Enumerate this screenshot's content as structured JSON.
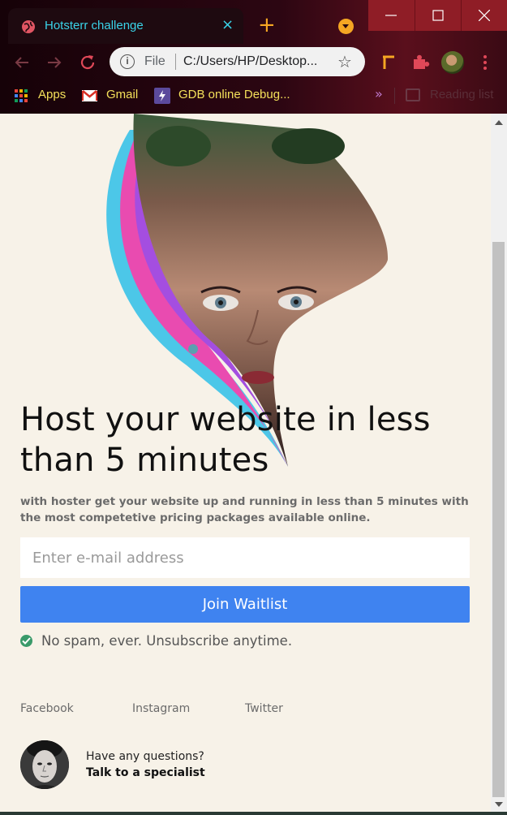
{
  "browser": {
    "tab": {
      "title": "Hotsterr challenge",
      "close": "×"
    },
    "new_tab": "+",
    "omnibox": {
      "scheme": "File",
      "url": "C:/Users/HP/Desktop...",
      "info": "i"
    },
    "bookmarks": [
      {
        "label": "Apps"
      },
      {
        "label": "Gmail"
      },
      {
        "label": "GDB online Debug..."
      }
    ],
    "more_bookmarks": "»",
    "reading_list": "Reading list",
    "accent": "#3ad3e8"
  },
  "page": {
    "headline": "Host your website in less than 5 minutes",
    "subtext": "with hoster get your website up and running in less than 5 minutes with the most competetive pricing packages available online.",
    "email_placeholder": "Enter e-mail address",
    "join_label": "Join Waitlist",
    "no_spam": "No spam, ever. Unsubscribe anytime.",
    "social": {
      "facebook": "Facebook",
      "instagram": "Instagram",
      "twitter": "Twitter"
    },
    "contact": {
      "question": "Have any questions?",
      "cta": "Talk to a specialist"
    },
    "colors": {
      "background": "#f7f2e8",
      "button": "#3f83f0",
      "check": "#3a9a6a"
    }
  }
}
